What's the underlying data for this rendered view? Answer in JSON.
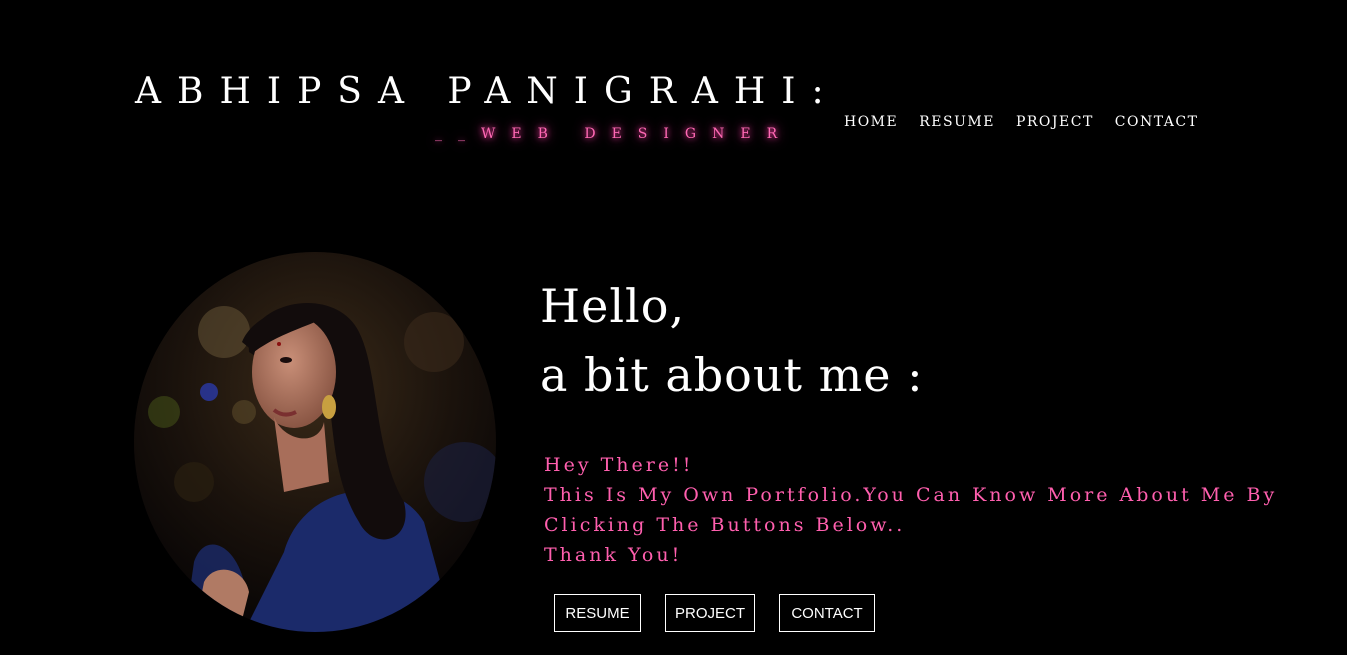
{
  "header": {
    "title": "ABHIPSA PANIGRAHI:",
    "subtitle": "__WEB DESIGNER"
  },
  "nav": {
    "items": [
      {
        "label": "HOME"
      },
      {
        "label": "RESUME"
      },
      {
        "label": "PROJECT"
      },
      {
        "label": "CONTACT"
      }
    ]
  },
  "hero": {
    "greeting_line1": "Hello,",
    "greeting_line2": "a bit about me :",
    "intro_lines": [
      "Hey There!!",
      "This Is My Own Portfolio.You Can Know More About Me By",
      "Clicking The Buttons Below..",
      "Thank You!"
    ]
  },
  "buttons": {
    "resume": "RESUME",
    "project": "PROJECT",
    "contact": "CONTACT"
  },
  "colors": {
    "background": "#000000",
    "accent_pink": "#ff5fae",
    "text": "#ffffff"
  }
}
